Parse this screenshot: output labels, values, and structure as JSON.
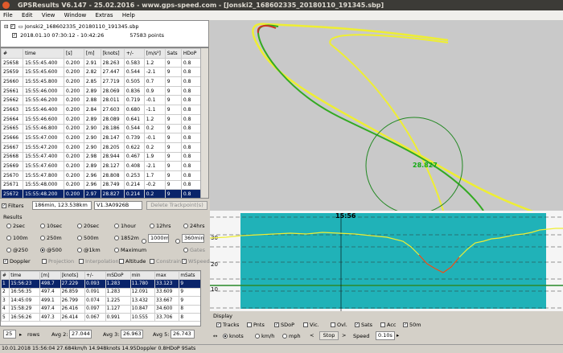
{
  "title": "GPSResults V6.147 - 25.02.2016 - www.gps-speed.com - [Jonski2_168602335_20180110_191345.sbp]",
  "menu": [
    "File",
    "Edit",
    "View",
    "Window",
    "Extras",
    "Help"
  ],
  "tree": {
    "file": "Jonski2_168602335_20180110_191345.sbp",
    "session": "2018.01.10 07:30:12 - 10:42:26",
    "points": "57583 points"
  },
  "grid": {
    "headers": [
      "#",
      "time",
      "[s]",
      "[m]",
      "[knots]",
      "+/-",
      "[m/s²]",
      "Sats",
      "HDoP"
    ],
    "rows": [
      [
        "25658",
        "15:55:45.400",
        "0.200",
        "2.91",
        "28.263",
        "0.583",
        "1.2",
        "9",
        "0.8"
      ],
      [
        "25659",
        "15:55:45.600",
        "0.200",
        "2.82",
        "27.447",
        "0.544",
        "-2.1",
        "9",
        "0.8"
      ],
      [
        "25660",
        "15:55:45.800",
        "0.200",
        "2.85",
        "27.719",
        "0.505",
        "0.7",
        "9",
        "0.8"
      ],
      [
        "25661",
        "15:55:46.000",
        "0.200",
        "2.89",
        "28.069",
        "0.836",
        "0.9",
        "9",
        "0.8"
      ],
      [
        "25662",
        "15:55:46.200",
        "0.200",
        "2.88",
        "28.011",
        "0.719",
        "-0.1",
        "9",
        "0.8"
      ],
      [
        "25663",
        "15:55:46.400",
        "0.200",
        "2.84",
        "27.603",
        "0.680",
        "-1.1",
        "9",
        "0.8"
      ],
      [
        "25664",
        "15:55:46.600",
        "0.200",
        "2.89",
        "28.089",
        "0.641",
        "1.2",
        "9",
        "0.8"
      ],
      [
        "25665",
        "15:55:46.800",
        "0.200",
        "2.90",
        "28.186",
        "0.544",
        "0.2",
        "9",
        "0.8"
      ],
      [
        "25666",
        "15:55:47.000",
        "0.200",
        "2.90",
        "28.147",
        "0.739",
        "-0.1",
        "9",
        "0.8"
      ],
      [
        "25667",
        "15:55:47.200",
        "0.200",
        "2.90",
        "28.205",
        "0.622",
        "0.2",
        "9",
        "0.8"
      ],
      [
        "25668",
        "15:55:47.400",
        "0.200",
        "2.98",
        "28.944",
        "0.467",
        "1.9",
        "9",
        "0.8"
      ],
      [
        "25669",
        "15:55:47.600",
        "0.200",
        "2.89",
        "28.127",
        "0.408",
        "-2.1",
        "9",
        "0.8"
      ],
      [
        "25670",
        "15:55:47.800",
        "0.200",
        "2.96",
        "28.808",
        "0.253",
        "1.7",
        "9",
        "0.8"
      ],
      [
        "25671",
        "15:55:48.000",
        "0.200",
        "2.96",
        "28.749",
        "0.214",
        "-0.2",
        "9",
        "0.8"
      ],
      [
        "25672",
        "15:55:48.200",
        "0.200",
        "2.97",
        "28.827",
        "0.214",
        "0.2",
        "9",
        "0.8"
      ],
      [
        "25673",
        "15:55:48.400",
        "0.200",
        "2.89",
        "28.030",
        "0.214",
        "0.2",
        "9",
        "0.8"
      ]
    ],
    "selected_index": 14
  },
  "filters": {
    "label": "Filters",
    "value1": "186min, 123.538km",
    "value2": "V1.3A0926B",
    "delete_label": "Delete Trackpoint(s)"
  },
  "results": {
    "group_label": "Results",
    "options": [
      "2sec",
      "10sec",
      "20sec",
      "1hour",
      "12hrs",
      "24hrs",
      "100m",
      "250m",
      "500m",
      "1852m",
      "1000m",
      "360min",
      "@250",
      "@500",
      "@1km",
      "Maximum",
      "Gates"
    ],
    "checks": [
      "Doppler",
      "Projection",
      "Interpolation",
      "Altitude",
      "Constrain",
      "WSpeed"
    ],
    "headers": [
      "#",
      "time",
      "[m]",
      "[knots]",
      "+/-",
      "mSDoP",
      "min",
      "max",
      "mSats"
    ],
    "rows": [
      [
        "1",
        "15:56:23",
        "498.7",
        "27.229",
        "0.093",
        "1.283",
        "11.780",
        "33.123",
        "9"
      ],
      [
        "2",
        "16:56:35",
        "497.4",
        "26.859",
        "0.091",
        "1.283",
        "12.091",
        "33.609",
        "9"
      ],
      [
        "3",
        "14:45:09",
        "499.1",
        "26.799",
        "0.074",
        "1.225",
        "13.432",
        "33.667",
        "9"
      ],
      [
        "4",
        "15:58:29",
        "497.4",
        "26.416",
        "0.097",
        "1.127",
        "10.847",
        "34.600",
        "8"
      ],
      [
        "5",
        "16:56:26",
        "497.3",
        "26.414",
        "0.067",
        "0.991",
        "10.555",
        "33.706",
        "8"
      ]
    ],
    "rows_count": "25",
    "rows_label": "rows",
    "avg2_label": "Avg 2:",
    "avg2": "27.044",
    "avg3_label": "Avg 3:",
    "avg3": "26.963",
    "avg5_label": "Avg 5:",
    "avg5": "26.743"
  },
  "map": {
    "speed_label": "28.827"
  },
  "chart": {
    "time_label": "15:56",
    "ytick_30": "30",
    "ytick_20": "20",
    "ytick_10": "10",
    "bg_color": "#20b2b8"
  },
  "display": {
    "title": "Display",
    "checks": [
      "Tracks",
      "Pnts",
      "SDoP",
      "Vic.",
      "Ovl.",
      "Sats",
      "Acc",
      "50m"
    ],
    "units": [
      "knots",
      "km/h",
      "mph"
    ],
    "stop_label": "Stop",
    "speed_label": "Speed",
    "speed_value": "0.10s"
  },
  "status": "10.01.2018 15:56:04 27.684km/h 14.948knots 14.95Doppler  0.8HDoP  9Sats"
}
